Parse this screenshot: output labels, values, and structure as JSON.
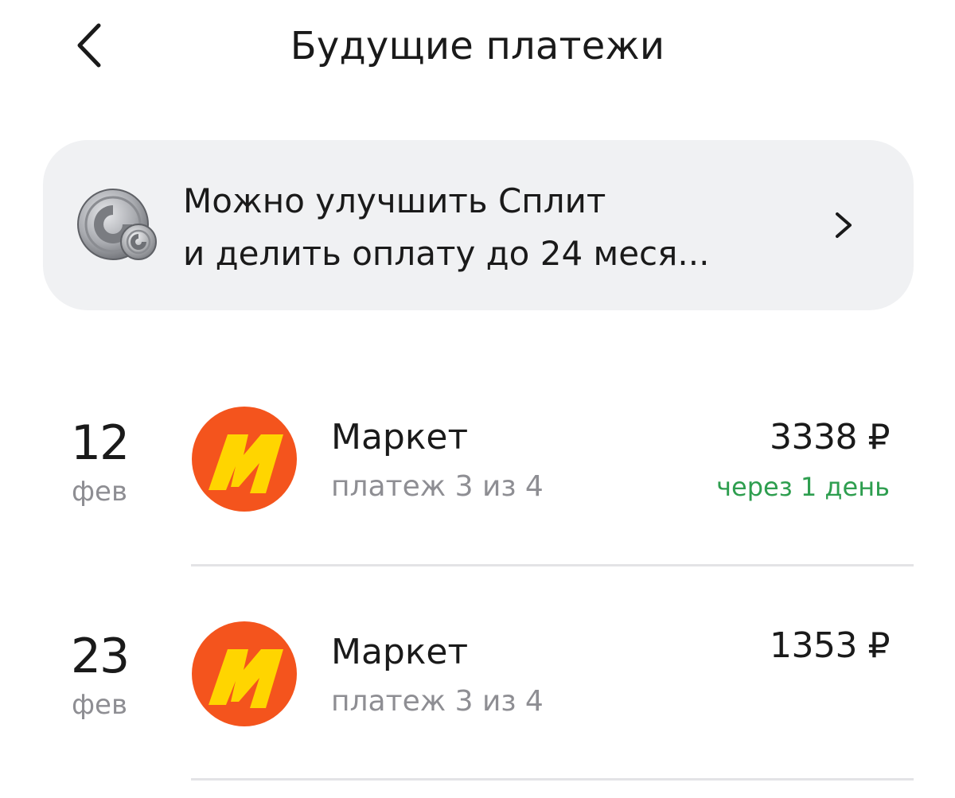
{
  "header": {
    "title": "Будущие платежи",
    "back_icon": "chevron-left-icon"
  },
  "promo": {
    "line1": "Можно улучшить Сплит",
    "line2": "и делить оплату до 24 меся...",
    "icon": "split-coin-icon",
    "chevron_icon": "chevron-right-icon",
    "background": "#f0f1f3"
  },
  "payments": [
    {
      "day": "12",
      "month": "фев",
      "merchant": "Маркет",
      "subtitle": "платеж 3 из 4",
      "amount": "3338 ₽",
      "due": "через 1 день",
      "logo": "yandex-market-logo"
    },
    {
      "day": "23",
      "month": "фев",
      "merchant": "Маркет",
      "subtitle": "платеж 3 из 4",
      "amount": "1353 ₽",
      "due": "",
      "logo": "yandex-market-logo"
    }
  ],
  "colors": {
    "due_text": "#2e9e4f",
    "secondary_text": "#8e8e93",
    "market_logo_red": "#f4541d",
    "market_logo_yellow": "#ffd500"
  }
}
